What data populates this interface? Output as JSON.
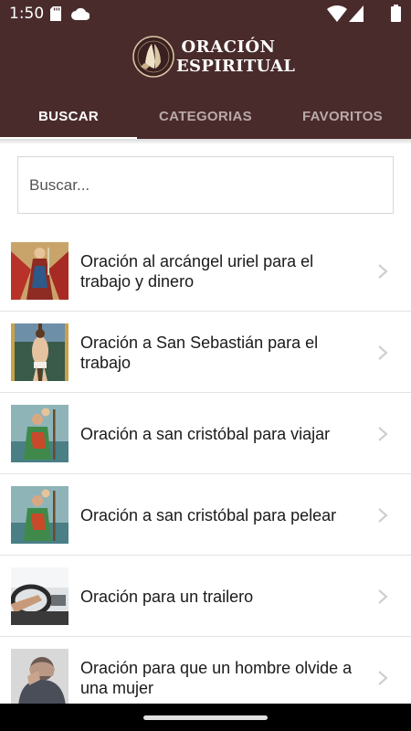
{
  "status_bar": {
    "time": "1:50",
    "icons": [
      "sd-card-icon",
      "cloud-icon",
      "wifi-icon",
      "signal-icon"
    ]
  },
  "header": {
    "title_line1": "ORACIÓN",
    "title_line2": "ESPIRITUAL",
    "logo_icon": "praying-hands-icon"
  },
  "tabs": [
    {
      "label": "BUSCAR",
      "active": true
    },
    {
      "label": "CATEGORIAS",
      "active": false
    },
    {
      "label": "FAVORITOS",
      "active": false
    }
  ],
  "search": {
    "placeholder": "Buscar...",
    "value": ""
  },
  "list": {
    "items": [
      {
        "label": "Oración al arcángel uriel para el trabajo y dinero",
        "thumb": "archangel-uriel-image"
      },
      {
        "label": "Oración a San Sebastián para el trabajo",
        "thumb": "san-sebastian-image"
      },
      {
        "label": "Oración a san cristóbal para viajar",
        "thumb": "san-cristobal-image"
      },
      {
        "label": "Oración a san cristóbal para pelear",
        "thumb": "san-cristobal-image"
      },
      {
        "label": "Oración para un trailero",
        "thumb": "truck-driver-image"
      },
      {
        "label": "Oración para que un hombre olvide a una mujer",
        "thumb": "sad-man-image"
      }
    ]
  },
  "colors": {
    "header_bg": "#4a2b2b",
    "tab_inactive": "#b9a9a9",
    "tab_active": "#ffffff"
  }
}
